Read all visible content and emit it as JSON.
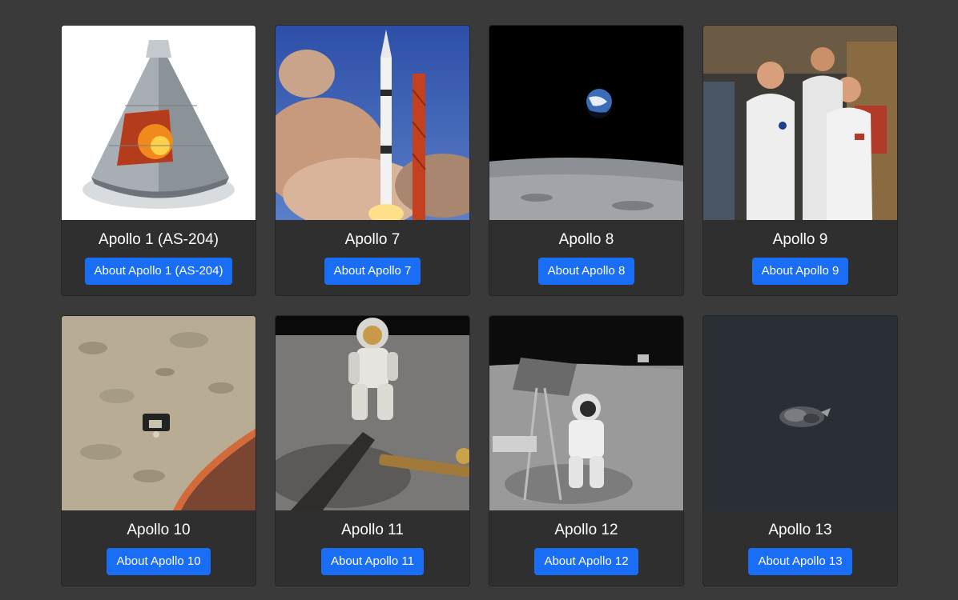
{
  "colors": {
    "page_background": "#3a3a3a",
    "card_background": "#2f2f2f",
    "button": "#1a6ef5",
    "text": "#ffffff"
  },
  "missions": [
    {
      "title": "Apollo 1 (AS-204)",
      "button_label": "About Apollo 1 (AS-204)",
      "image": "command-module-cutaway-image"
    },
    {
      "title": "Apollo 7",
      "button_label": "About Apollo 7",
      "image": "saturn-rocket-launch-image"
    },
    {
      "title": "Apollo 8",
      "button_label": "About Apollo 8",
      "image": "earthrise-image"
    },
    {
      "title": "Apollo 9",
      "button_label": "About Apollo 9",
      "image": "astronaut-crew-image"
    },
    {
      "title": "Apollo 10",
      "button_label": "About Apollo 10",
      "image": "lunar-module-over-moon-image"
    },
    {
      "title": "Apollo 11",
      "button_label": "About Apollo 11",
      "image": "astronaut-on-moon-image"
    },
    {
      "title": "Apollo 12",
      "button_label": "About Apollo 12",
      "image": "astronaut-with-surveyor-image"
    },
    {
      "title": "Apollo 13",
      "button_label": "About Apollo 13",
      "image": "service-module-in-space-image"
    }
  ]
}
